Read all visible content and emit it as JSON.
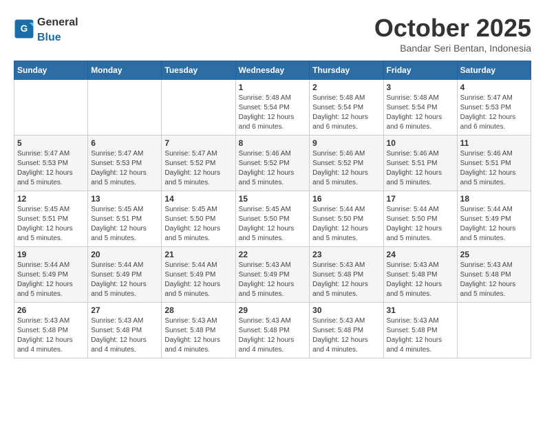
{
  "header": {
    "logo_general": "General",
    "logo_blue": "Blue",
    "month_title": "October 2025",
    "subtitle": "Bandar Seri Bentan, Indonesia"
  },
  "days_of_week": [
    "Sunday",
    "Monday",
    "Tuesday",
    "Wednesday",
    "Thursday",
    "Friday",
    "Saturday"
  ],
  "weeks": [
    [
      {
        "day": "",
        "info": ""
      },
      {
        "day": "",
        "info": ""
      },
      {
        "day": "",
        "info": ""
      },
      {
        "day": "1",
        "info": "Sunrise: 5:48 AM\nSunset: 5:54 PM\nDaylight: 12 hours\nand 6 minutes."
      },
      {
        "day": "2",
        "info": "Sunrise: 5:48 AM\nSunset: 5:54 PM\nDaylight: 12 hours\nand 6 minutes."
      },
      {
        "day": "3",
        "info": "Sunrise: 5:48 AM\nSunset: 5:54 PM\nDaylight: 12 hours\nand 6 minutes."
      },
      {
        "day": "4",
        "info": "Sunrise: 5:47 AM\nSunset: 5:53 PM\nDaylight: 12 hours\nand 6 minutes."
      }
    ],
    [
      {
        "day": "5",
        "info": "Sunrise: 5:47 AM\nSunset: 5:53 PM\nDaylight: 12 hours\nand 5 minutes."
      },
      {
        "day": "6",
        "info": "Sunrise: 5:47 AM\nSunset: 5:53 PM\nDaylight: 12 hours\nand 5 minutes."
      },
      {
        "day": "7",
        "info": "Sunrise: 5:47 AM\nSunset: 5:52 PM\nDaylight: 12 hours\nand 5 minutes."
      },
      {
        "day": "8",
        "info": "Sunrise: 5:46 AM\nSunset: 5:52 PM\nDaylight: 12 hours\nand 5 minutes."
      },
      {
        "day": "9",
        "info": "Sunrise: 5:46 AM\nSunset: 5:52 PM\nDaylight: 12 hours\nand 5 minutes."
      },
      {
        "day": "10",
        "info": "Sunrise: 5:46 AM\nSunset: 5:51 PM\nDaylight: 12 hours\nand 5 minutes."
      },
      {
        "day": "11",
        "info": "Sunrise: 5:46 AM\nSunset: 5:51 PM\nDaylight: 12 hours\nand 5 minutes."
      }
    ],
    [
      {
        "day": "12",
        "info": "Sunrise: 5:45 AM\nSunset: 5:51 PM\nDaylight: 12 hours\nand 5 minutes."
      },
      {
        "day": "13",
        "info": "Sunrise: 5:45 AM\nSunset: 5:51 PM\nDaylight: 12 hours\nand 5 minutes."
      },
      {
        "day": "14",
        "info": "Sunrise: 5:45 AM\nSunset: 5:50 PM\nDaylight: 12 hours\nand 5 minutes."
      },
      {
        "day": "15",
        "info": "Sunrise: 5:45 AM\nSunset: 5:50 PM\nDaylight: 12 hours\nand 5 minutes."
      },
      {
        "day": "16",
        "info": "Sunrise: 5:44 AM\nSunset: 5:50 PM\nDaylight: 12 hours\nand 5 minutes."
      },
      {
        "day": "17",
        "info": "Sunrise: 5:44 AM\nSunset: 5:50 PM\nDaylight: 12 hours\nand 5 minutes."
      },
      {
        "day": "18",
        "info": "Sunrise: 5:44 AM\nSunset: 5:49 PM\nDaylight: 12 hours\nand 5 minutes."
      }
    ],
    [
      {
        "day": "19",
        "info": "Sunrise: 5:44 AM\nSunset: 5:49 PM\nDaylight: 12 hours\nand 5 minutes."
      },
      {
        "day": "20",
        "info": "Sunrise: 5:44 AM\nSunset: 5:49 PM\nDaylight: 12 hours\nand 5 minutes."
      },
      {
        "day": "21",
        "info": "Sunrise: 5:44 AM\nSunset: 5:49 PM\nDaylight: 12 hours\nand 5 minutes."
      },
      {
        "day": "22",
        "info": "Sunrise: 5:43 AM\nSunset: 5:49 PM\nDaylight: 12 hours\nand 5 minutes."
      },
      {
        "day": "23",
        "info": "Sunrise: 5:43 AM\nSunset: 5:48 PM\nDaylight: 12 hours\nand 5 minutes."
      },
      {
        "day": "24",
        "info": "Sunrise: 5:43 AM\nSunset: 5:48 PM\nDaylight: 12 hours\nand 5 minutes."
      },
      {
        "day": "25",
        "info": "Sunrise: 5:43 AM\nSunset: 5:48 PM\nDaylight: 12 hours\nand 5 minutes."
      }
    ],
    [
      {
        "day": "26",
        "info": "Sunrise: 5:43 AM\nSunset: 5:48 PM\nDaylight: 12 hours\nand 4 minutes."
      },
      {
        "day": "27",
        "info": "Sunrise: 5:43 AM\nSunset: 5:48 PM\nDaylight: 12 hours\nand 4 minutes."
      },
      {
        "day": "28",
        "info": "Sunrise: 5:43 AM\nSunset: 5:48 PM\nDaylight: 12 hours\nand 4 minutes."
      },
      {
        "day": "29",
        "info": "Sunrise: 5:43 AM\nSunset: 5:48 PM\nDaylight: 12 hours\nand 4 minutes."
      },
      {
        "day": "30",
        "info": "Sunrise: 5:43 AM\nSunset: 5:48 PM\nDaylight: 12 hours\nand 4 minutes."
      },
      {
        "day": "31",
        "info": "Sunrise: 5:43 AM\nSunset: 5:48 PM\nDaylight: 12 hours\nand 4 minutes."
      },
      {
        "day": "",
        "info": ""
      }
    ]
  ]
}
